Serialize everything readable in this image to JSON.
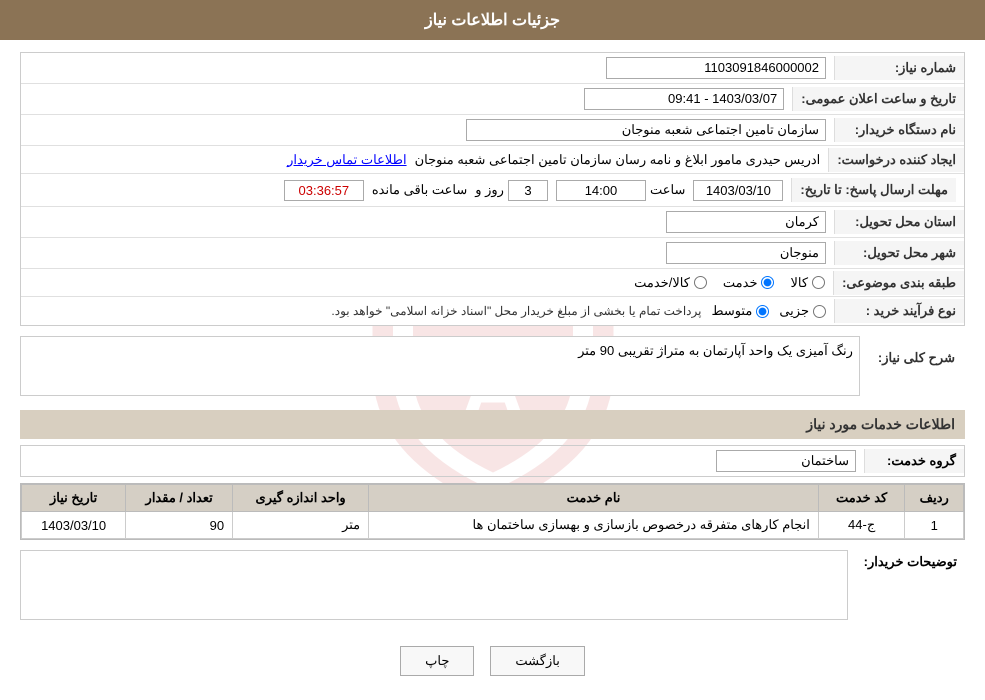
{
  "header": {
    "title": "جزئیات اطلاعات نیاز"
  },
  "fields": {
    "shomareNiaz_label": "شماره نیاز:",
    "shomareNiaz_value": "1103091846000002",
    "namDastgah_label": "نام دستگاه خریدار:",
    "namDastgah_value": "سازمان تامین اجتماعی شعبه منوجان",
    "ijadKonande_label": "ایجاد کننده درخواست:",
    "ijadKonande_value": "ادریس حیدری مامور ابلاغ و نامه رسان سازمان تامین اجتماعی شعبه منوجان",
    "ettelaat_link": "اطلاعات تماس خریدار",
    "tarikhLabel": "تاریخ و ساعت اعلان عمومی:",
    "tarikhValue": "1403/03/07 - 09:41",
    "mohlat_label": "مهلت ارسال پاسخ: تا تاریخ:",
    "mohlat_date": "1403/03/10",
    "mohlat_saat_label": "ساعت",
    "mohlat_saat": "14:00",
    "mohlat_rooz_label": "روز و",
    "mohlat_rooz": "3",
    "mohlat_baghimande": "ساعت باقی مانده",
    "mohlat_baghimande_val": "03:36:57",
    "ostan_label": "استان محل تحویل:",
    "ostan_value": "کرمان",
    "shahr_label": "شهر محل تحویل:",
    "shahr_value": "منوجان",
    "tabaqehbandi_label": "طبقه بندی موضوعی:",
    "tabaqeh_options": [
      "کالا",
      "خدمت",
      "کالا/خدمت"
    ],
    "tabaqeh_selected": "خدمت",
    "noefarayand_label": "نوع فرآیند خرید :",
    "noefarayand_options": [
      "جزیی",
      "متوسط"
    ],
    "noefarayand_selected": "متوسط",
    "noefarayand_note": "پرداخت تمام یا بخشی از مبلغ خریدار محل \"اسناد خزانه اسلامی\" خواهد بود.",
    "sharh_label": "شرح کلی نیاز:",
    "sharh_value": "رنگ آمیزی یک واحد آپارتمان به متراژ تقریبی 90 متر",
    "services_title": "اطلاعات خدمات مورد نیاز",
    "grouh_label": "گروه خدمت:",
    "grouh_value": "ساختمان",
    "table": {
      "headers": [
        "ردیف",
        "کد خدمت",
        "نام خدمت",
        "واحد اندازه گیری",
        "تعداد / مقدار",
        "تاریخ نیاز"
      ],
      "rows": [
        {
          "radif": "1",
          "kod": "ج-44",
          "name": "انجام کارهای متفرقه درخصوص بازسازی و بهسازی ساختمان ها",
          "vahed": "متر",
          "tedad": "90",
          "tarikh": "1403/03/10"
        }
      ]
    },
    "tozihat_label": "توضیحات خریدار:",
    "back_btn": "بازگشت",
    "print_btn": "چاپ"
  }
}
